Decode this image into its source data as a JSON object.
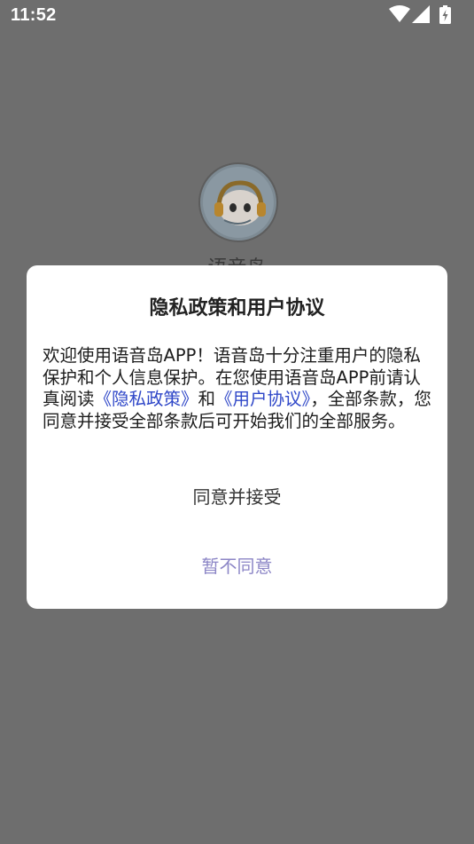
{
  "status_bar": {
    "time": "11:52",
    "icons": [
      "wifi-icon",
      "cell-signal-icon",
      "battery-charging-icon"
    ]
  },
  "app": {
    "name": "语音岛",
    "logo_icon": "headphone-mascot-logo"
  },
  "dialog": {
    "title": "隐私政策和用户协议",
    "body": {
      "part1": "欢迎使用语音岛APP！语音岛十分注重用户的隐私保护和个人信息保护。在您使用语音岛APP前请认真阅读",
      "privacy_link": "《隐私政策》",
      "conjunction": "和",
      "agreement_link": "《用户协议》",
      "part2": "，全部条款，您同意并接受全部条款后可开始我们的全部服务。"
    },
    "accept_label": "同意并接受",
    "decline_label": "暂不同意"
  },
  "colors": {
    "overlay_background": "#6e6e6e",
    "dialog_background": "#ffffff",
    "link": "#2f47c8",
    "decline_text": "#8c86c6"
  }
}
